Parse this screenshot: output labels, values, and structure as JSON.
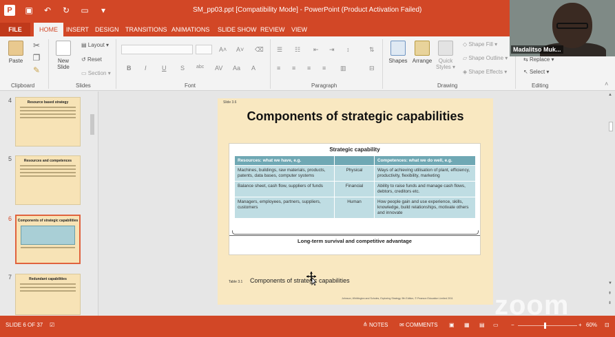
{
  "window": {
    "title": "SM_pp03.ppt [Compatibility Mode] - PowerPoint (Product Activation Failed)"
  },
  "ribbon": {
    "tabs": [
      "FILE",
      "HOME",
      "INSERT",
      "DESIGN",
      "TRANSITIONS",
      "ANIMATIONS",
      "SLIDE SHOW",
      "REVIEW",
      "VIEW"
    ],
    "active_tab": "HOME",
    "groups": {
      "clipboard": "Clipboard",
      "slides": "Slides",
      "font": "Font",
      "paragraph": "Paragraph",
      "drawing": "Drawing",
      "editing": "Editing"
    },
    "buttons": {
      "paste": "Paste",
      "new_slide": "New Slide",
      "new_slide_arrow": "Slide ▾",
      "layout": "Layout ▾",
      "reset": "Reset",
      "section": "Section ▾",
      "shapes": "Shapes",
      "arrange": "Arrange",
      "quick_styles": "Quick Styles ▾",
      "shape_fill": "Shape Fill ▾",
      "shape_outline": "Shape Outline ▾",
      "shape_effects": "Shape Effects ▾",
      "replace": "Replace ▾",
      "select": "Select ▾"
    }
  },
  "thumbnails": [
    {
      "num": "4",
      "title": "Resource based strategy"
    },
    {
      "num": "5",
      "title": "Resources and competences"
    },
    {
      "num": "6",
      "title": "Components of strategic capabilities"
    },
    {
      "num": "7",
      "title": "Redundant capabilities"
    }
  ],
  "slide": {
    "number_label": "Slide 3.6",
    "title": "Components of strategic capabilities",
    "figure_title": "Strategic capability",
    "headers": [
      "Resources: what we have, e.g.",
      "",
      "Competences: what we do well, e.g."
    ],
    "rows": [
      {
        "resources": "Machines, buildings, raw materials, products, patents, data bases, computer systems",
        "type": "Physical",
        "competences": "Ways of achieving utilisation of plant, efficiency, productivity, flexibility, marketing"
      },
      {
        "resources": "Balance sheet, cash flow, suppliers of funds",
        "type": "Financial",
        "competences": "Ability to raise funds and manage cash flows, debtors, creditors etc."
      },
      {
        "resources": "Managers, employees, partners, suppliers, customers",
        "type": "Human",
        "competences": "How people gain and use experience, skills, knowledge, build relationships, motivate others and innovate"
      }
    ],
    "figure_footer": "Long-term survival and competitive advantage",
    "caption_label": "Table 3.1",
    "caption": "Components of strategic capabilities",
    "credits": "Johnson, Whittington and Scholes, Exploring Strategy, 9th Edition, © Pearson Education Limited 2011"
  },
  "status": {
    "slide_counter": "SLIDE 6 OF 37",
    "notes": "NOTES",
    "comments": "COMMENTS",
    "zoom": "60%"
  },
  "overlay": {
    "participant_name": "Madalitso Muk...",
    "watermark": "zoom"
  },
  "colors": {
    "accent": "#d24726",
    "slide_bg": "#f9e8c1",
    "table_header": "#6fa8b4",
    "table_cell": "#bfdde3"
  }
}
